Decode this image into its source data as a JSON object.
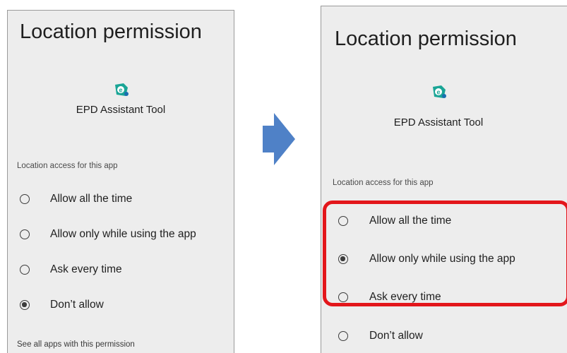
{
  "colors": {
    "panel_bg": "#ededed",
    "arrow": "#4f81c7",
    "highlight": "#e3161b",
    "icon_teal": "#1aa596"
  },
  "before": {
    "title": "Location permission",
    "app_icon": "epd-app-icon",
    "app_name": "EPD Assistant Tool",
    "section_label": "Location access for this app",
    "options": [
      {
        "label": "Allow all the time",
        "selected": false
      },
      {
        "label": "Allow only while using the app",
        "selected": false
      },
      {
        "label": "Ask every time",
        "selected": false
      },
      {
        "label": "Don’t allow",
        "selected": true
      }
    ],
    "footer_link": "See all apps with this permission"
  },
  "after": {
    "title": "Location permission",
    "app_icon": "epd-app-icon",
    "app_name": "EPD Assistant Tool",
    "section_label": "Location access for this app",
    "options": [
      {
        "label": "Allow all the time",
        "selected": false
      },
      {
        "label": "Allow only while using the app",
        "selected": true
      },
      {
        "label": "Ask every time",
        "selected": false
      },
      {
        "label": "Don’t allow",
        "selected": false
      }
    ]
  },
  "annotations": {
    "arrow_icon": "right-arrow-icon",
    "highlight": "red-highlight-box"
  }
}
